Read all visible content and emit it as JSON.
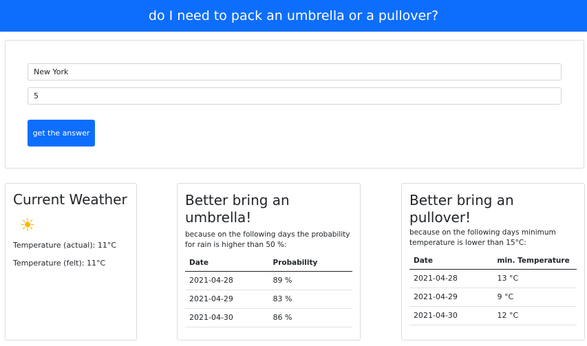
{
  "header": {
    "title": "do I need to pack an umbrella or a pullover?"
  },
  "form": {
    "city_value": "New York",
    "days_value": "5",
    "submit_label": "get the answer"
  },
  "current_weather": {
    "title": "Current Weather",
    "icon": "sun-icon",
    "temp_actual": "Temperature (actual): 11°C",
    "temp_felt": "Temperature (felt): 11°C"
  },
  "umbrella": {
    "title": "Better bring an umbrella!",
    "description": "because on the following days the probability for rain is higher than 50 %:",
    "columns": [
      "Date",
      "Probability"
    ],
    "rows": [
      [
        "2021-04-28",
        "89 %"
      ],
      [
        "2021-04-29",
        "83 %"
      ],
      [
        "2021-04-30",
        "86 %"
      ]
    ]
  },
  "pullover": {
    "title": "Better bring an pullover!",
    "description": "because on the following days minimum temperature is lower than 15°C:",
    "columns": [
      "Date",
      "min. Temperature"
    ],
    "rows": [
      [
        "2021-04-28",
        "13 °C"
      ],
      [
        "2021-04-29",
        "9 °C"
      ],
      [
        "2021-04-30",
        "12 °C"
      ]
    ]
  },
  "colors": {
    "primary": "#0d6efd",
    "sun": "#f5b800"
  }
}
